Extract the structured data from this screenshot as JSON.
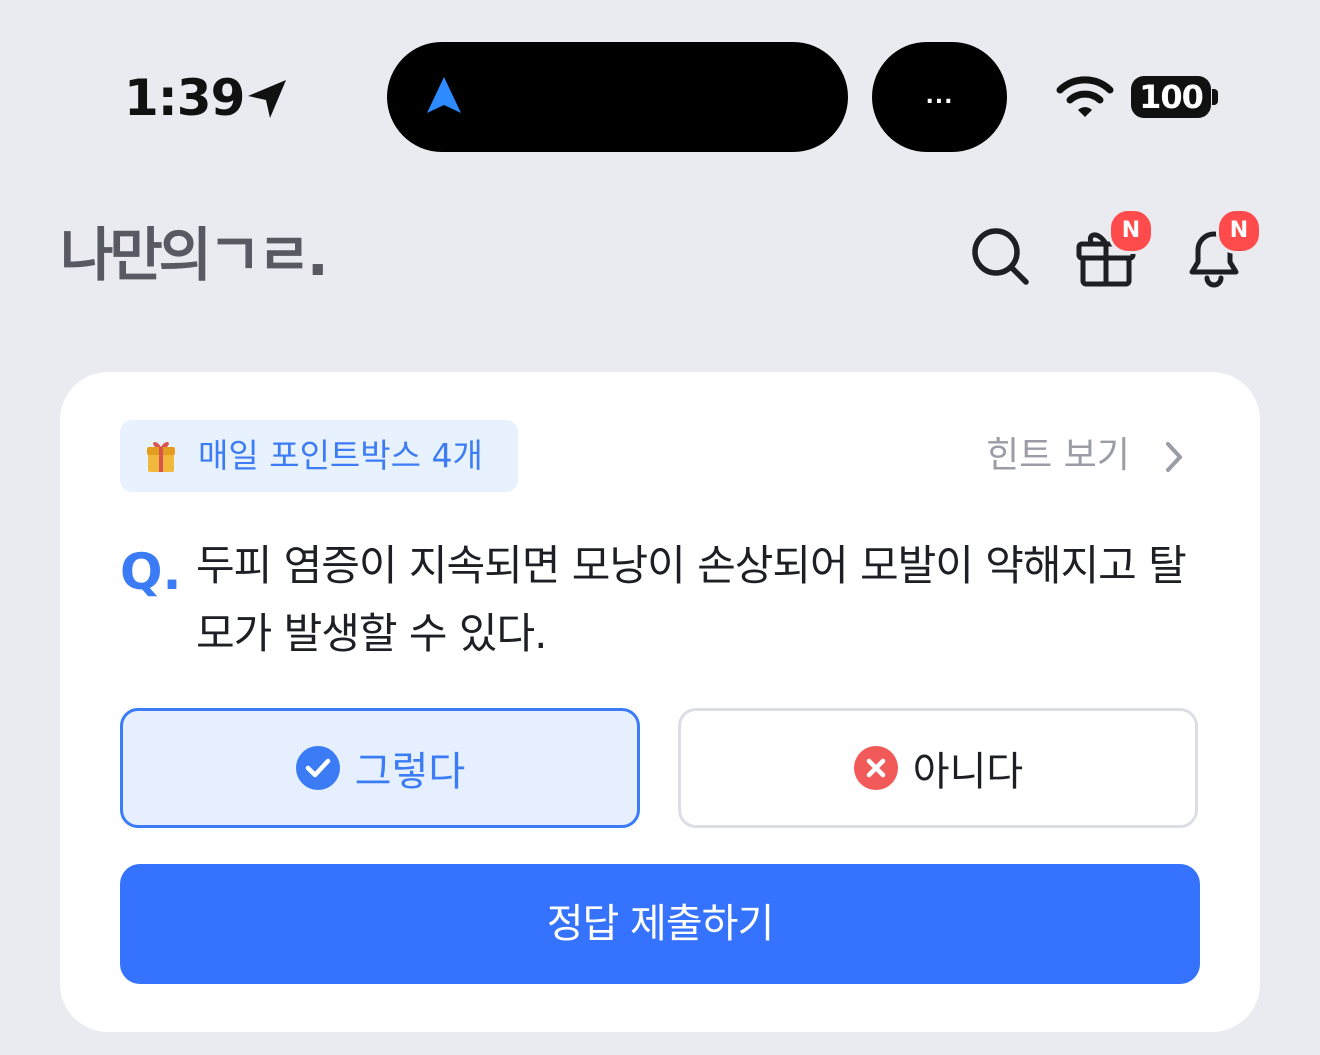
{
  "status_bar": {
    "time": "1:39",
    "island_more": "...",
    "battery": "100"
  },
  "header": {
    "logo": "나만의ㄱㄹ.",
    "icons": [
      "search-icon",
      "gift-icon",
      "bell-icon"
    ],
    "gift_badge": "N",
    "bell_badge": "N"
  },
  "quiz": {
    "point_chip": "매일 포인트박스 4개",
    "hint_label": "힌트 보기",
    "q_mark": "Q.",
    "question": "두피 염증이 지속되면 모낭이 손상되어 모발이 약해지고 탈모가 발생할 수 있다.",
    "options": [
      {
        "label": "그렇다",
        "selected": true
      },
      {
        "label": "아니다",
        "selected": false
      }
    ],
    "submit_label": "정답 제출하기"
  },
  "colors": {
    "accent": "#3572FE",
    "selected_bg": "#E5EFFE",
    "badge": "#FF4B4B",
    "background": "#E9EBF0"
  }
}
